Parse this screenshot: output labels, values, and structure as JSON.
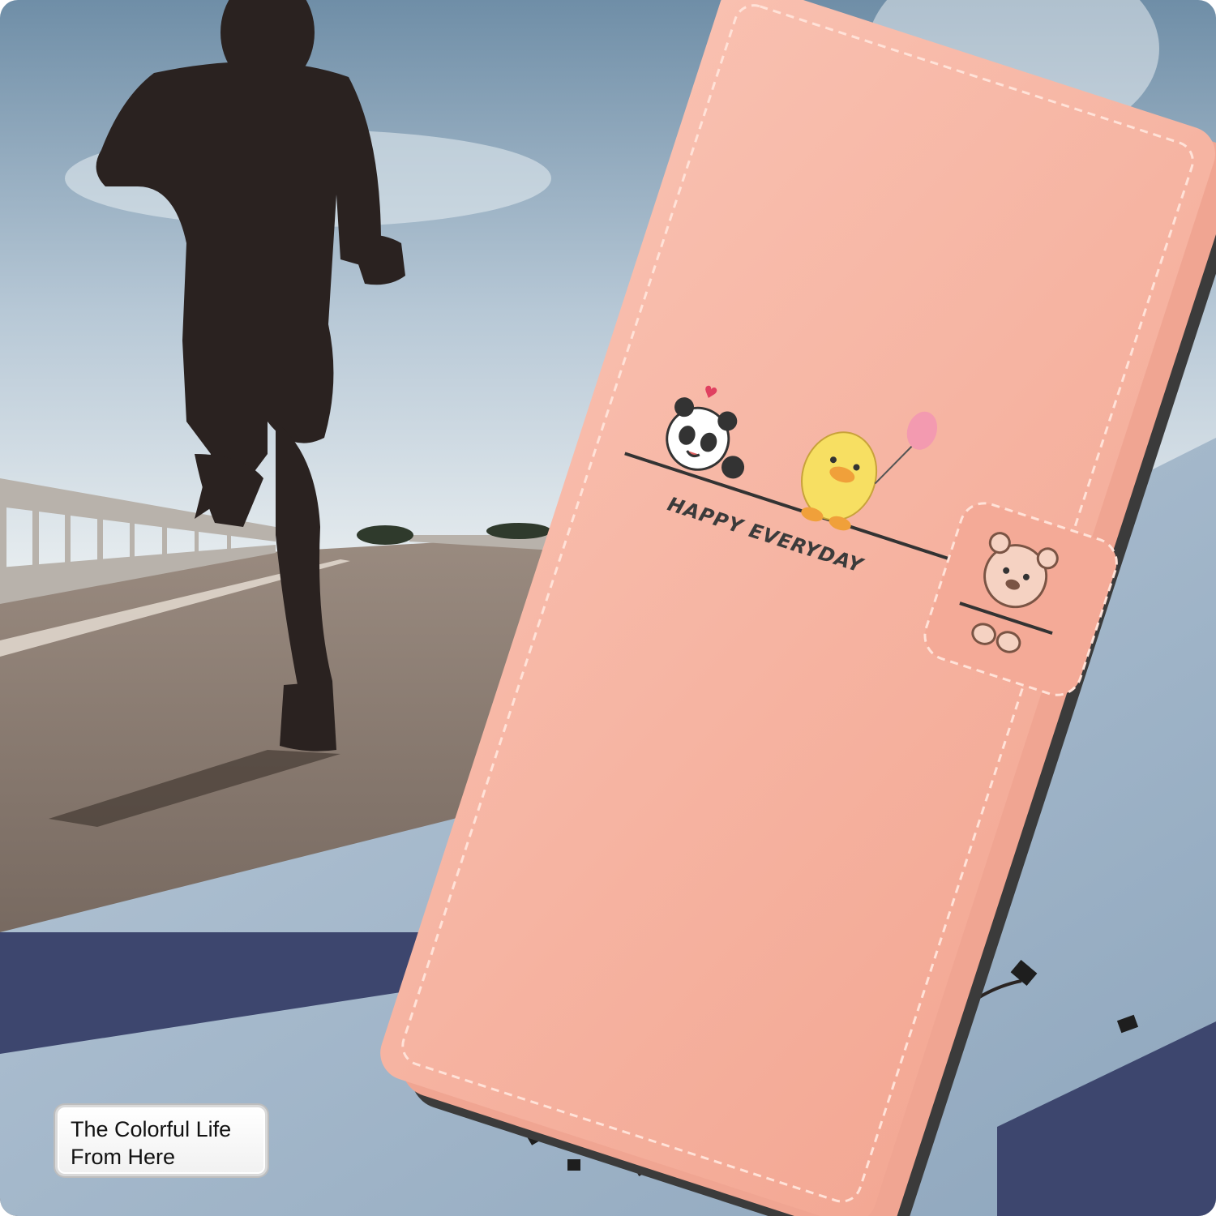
{
  "colors": {
    "sky_top": "#6f8ea7",
    "sky_bottom": "#dfe7ec",
    "road": "#6e6057",
    "ground_blue": "#9db2c6",
    "navy_band": "#3d466e",
    "case_pink": "#f7b3a1",
    "case_stitch": "#ffe2d8",
    "phone_edge": "#3b3b3b",
    "runner_silhouette": "#2a2220"
  },
  "case": {
    "print_text": "HAPPY EVERYDAY",
    "characters": [
      "panda",
      "duck",
      "bear"
    ]
  },
  "caption": {
    "line1": "The Colorful Life",
    "line2": "From Here"
  }
}
